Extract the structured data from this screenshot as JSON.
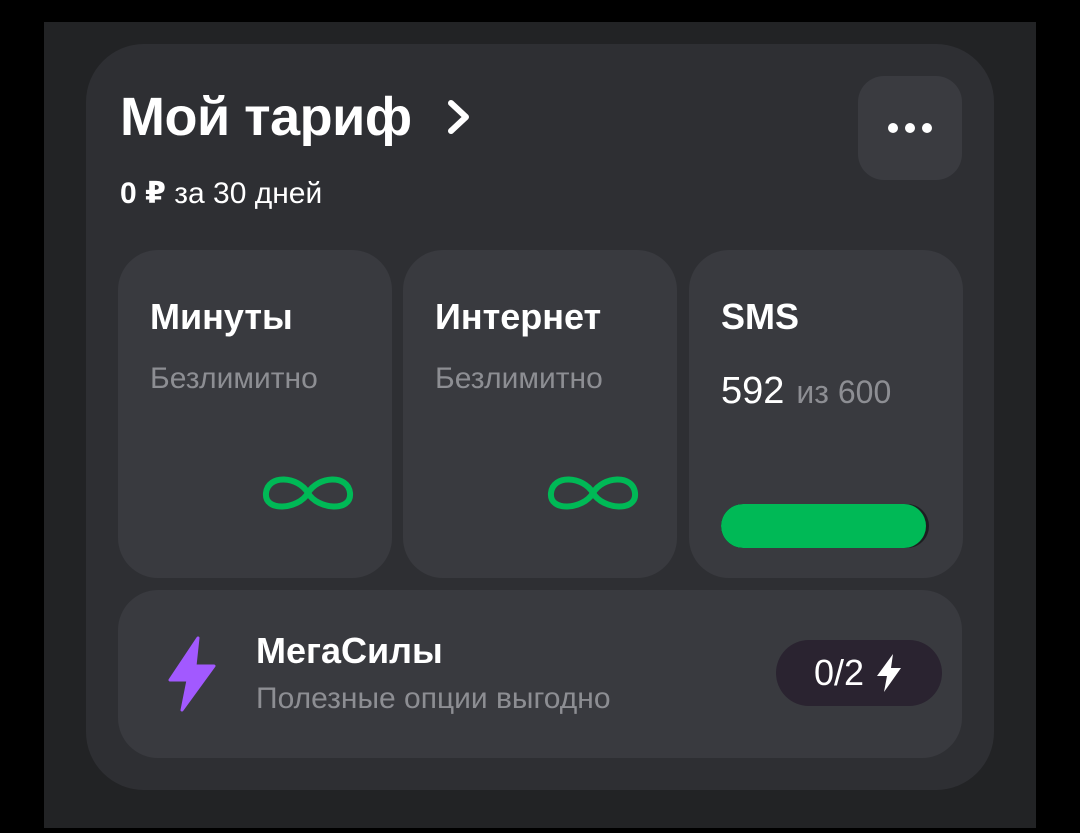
{
  "tariff": {
    "title": "Мой тариф",
    "price": "0 ₽",
    "period": "за 30 дней"
  },
  "tiles": {
    "minutes": {
      "title": "Минуты",
      "status": "Безлимитно",
      "icon": "infinity-icon"
    },
    "internet": {
      "title": "Интернет",
      "status": "Безлимитно",
      "icon": "infinity-icon"
    },
    "sms": {
      "title": "SMS",
      "remaining": "592",
      "total_label": "из 600",
      "fraction_remaining": 0.987
    }
  },
  "megasily": {
    "title": "МегаСилы",
    "subtitle": "Полезные опции выгодно",
    "count": "0/2",
    "icon": "lightning-bolt-icon"
  },
  "colors": {
    "accent_green": "#00b956",
    "accent_purple": "#a259ff",
    "card_bg": "#2e2f33",
    "tile_bg": "#393a3f"
  }
}
